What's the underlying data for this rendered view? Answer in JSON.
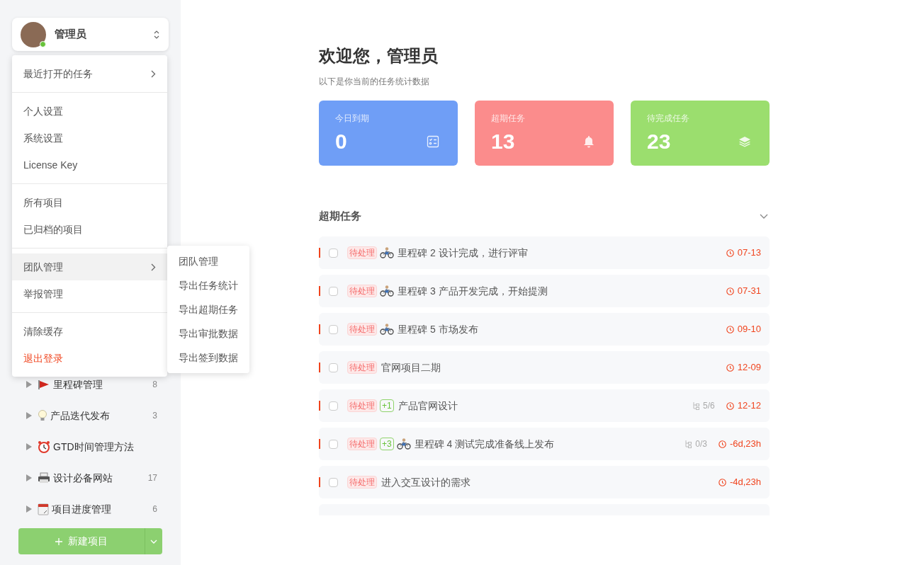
{
  "user": {
    "name": "管理员",
    "online": true
  },
  "menu": {
    "groups": [
      [
        {
          "label": "最近打开的任务",
          "submenu": true,
          "selected": false,
          "kind": "normal"
        }
      ],
      [
        {
          "label": "个人设置",
          "submenu": false,
          "selected": false,
          "kind": "normal"
        },
        {
          "label": "系统设置",
          "submenu": false,
          "selected": false,
          "kind": "normal"
        },
        {
          "label": "License Key",
          "submenu": false,
          "selected": false,
          "kind": "normal"
        }
      ],
      [
        {
          "label": "所有项目",
          "submenu": false,
          "selected": false,
          "kind": "normal"
        },
        {
          "label": "已归档的项目",
          "submenu": false,
          "selected": false,
          "kind": "normal"
        }
      ],
      [
        {
          "label": "团队管理",
          "submenu": true,
          "selected": true,
          "kind": "normal"
        },
        {
          "label": "举报管理",
          "submenu": false,
          "selected": false,
          "kind": "normal"
        }
      ],
      [
        {
          "label": "清除缓存",
          "submenu": false,
          "selected": false,
          "kind": "normal"
        },
        {
          "label": "退出登录",
          "submenu": false,
          "selected": false,
          "kind": "danger"
        }
      ]
    ]
  },
  "submenu": [
    "团队管理",
    "导出任务统计",
    "导出超期任务",
    "导出审批数据",
    "导出签到数据"
  ],
  "projects": [
    {
      "kind": "flag",
      "label": "里程碑管理",
      "count": "8"
    },
    {
      "kind": "bulb",
      "label": "产品迭代发布",
      "count": "3"
    },
    {
      "kind": "alarm",
      "label": "GTD时间管理方法"
    },
    {
      "kind": "printer",
      "label": "设计必备网站",
      "count": "17"
    },
    {
      "kind": "calendar",
      "label": "项目进度管理",
      "count": "6"
    }
  ],
  "new_project_button": "新建项目",
  "welcome": {
    "title": "欢迎您，管理员",
    "subtitle": "以下是你当前的任务统计数据"
  },
  "stats": [
    {
      "kind": "checklist",
      "label": "今日到期",
      "value": "0",
      "color": "#6f9ef6"
    },
    {
      "kind": "bell",
      "label": "超期任务",
      "value": "13",
      "color": "#fb8c8c"
    },
    {
      "kind": "layers",
      "label": "待完成任务",
      "value": "23",
      "color": "#9bde6e"
    }
  ],
  "section": {
    "title": "超期任务"
  },
  "tasks": [
    {
      "checked": false,
      "status": "待处理",
      "bike": true,
      "title": "里程碑 2 设计完成，进行评审",
      "due": "07-13"
    },
    {
      "checked": false,
      "status": "待处理",
      "bike": true,
      "title": "里程碑 3 产品开发完成，开始提测",
      "due": "07-31"
    },
    {
      "checked": false,
      "status": "待处理",
      "bike": true,
      "title": "里程碑 5 市场发布",
      "due": "09-10"
    },
    {
      "checked": false,
      "status": "待处理",
      "bike": false,
      "title": "官网项目二期",
      "due": "12-09"
    },
    {
      "checked": false,
      "status": "待处理",
      "extra": "+1",
      "bike": false,
      "title": "产品官网设计",
      "subtasks": "5/6",
      "due": "12-12"
    },
    {
      "checked": false,
      "status": "待处理",
      "extra": "+3",
      "bike": true,
      "title": "里程碑 4 测试完成准备线上发布",
      "subtasks": "0/3",
      "due": "-6d,23h"
    },
    {
      "checked": false,
      "status": "待处理",
      "bike": false,
      "title": "进入交互设计的需求",
      "due": "-4d,23h"
    }
  ]
}
